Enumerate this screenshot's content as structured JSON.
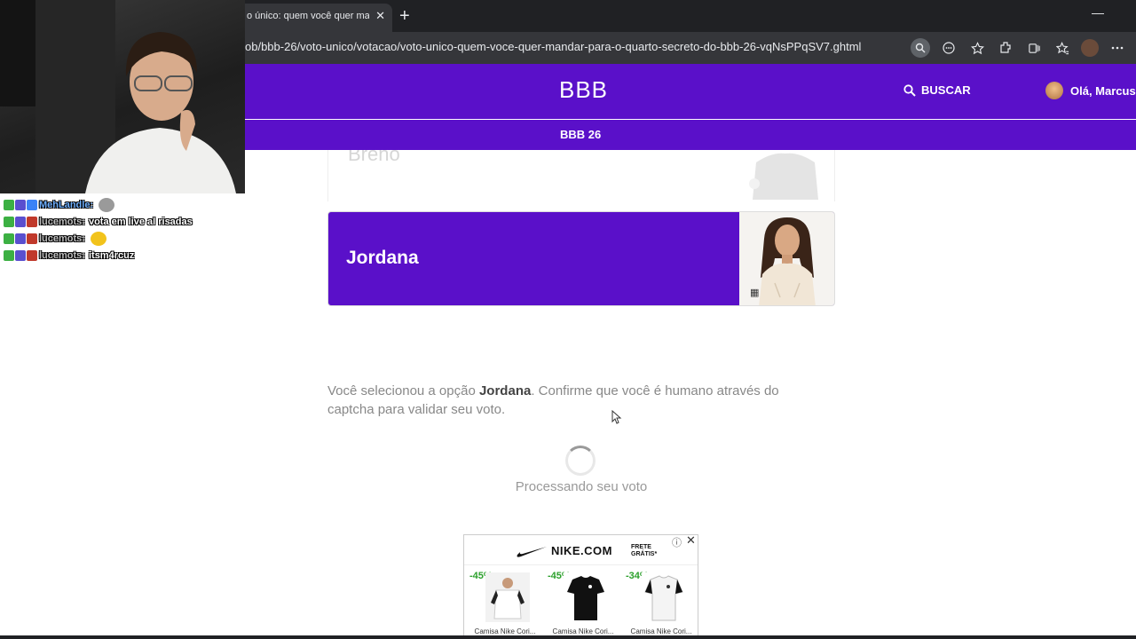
{
  "browser": {
    "tab_title": "o único: quem você quer mandar para o quarto secreto",
    "tab_close": "✕",
    "new_tab": "+",
    "minimize": "—",
    "url": "ob/bbb-26/voto-unico/votacao/voto-unico-quem-voce-quer-mandar-para-o-quarto-secreto-do-bbb-26-vqNsPPqSV7.ghtml",
    "toolbar_icons": [
      "zoom-icon",
      "reader-icon",
      "favorite-star-icon",
      "extensions-icon",
      "collections-icon",
      "favorites-icon",
      "profile-icon",
      "menu-icon"
    ]
  },
  "header": {
    "logo": "BBB",
    "search_label": "BUSCAR",
    "user_greeting": "Olá, Marcus",
    "subnav_label": "BBB 26",
    "brand_color": "#5a10c9"
  },
  "options": {
    "previous_name": "Breno",
    "selected_name": "Jordana"
  },
  "confirmation": {
    "prefix": "Você selecionou a opção ",
    "name": "Jordana",
    "suffix": ". Confirme que você é humano através do captcha para validar seu voto.",
    "processing": "Processando seu voto"
  },
  "ad": {
    "brand": "NIKE.COM",
    "shipping_line1": "FRETE",
    "shipping_line2": "GRÁTIS*",
    "info": "ⓘ",
    "close": "✕",
    "products": [
      {
        "discount": "-45%",
        "name": "Camisa Nike Cori..."
      },
      {
        "discount": "-45%",
        "name": "Camisa Nike Cori..."
      },
      {
        "discount": "-34%",
        "name": "Camisa Nike Cori..."
      }
    ]
  },
  "stream_chat": [
    {
      "user": "MehLandle:",
      "message": ""
    },
    {
      "user": "lucemots:",
      "message": "vota em live al risadas"
    },
    {
      "user": "lucemots:",
      "message": ""
    },
    {
      "user": "lucemots:",
      "message": "itsm4rcuz"
    }
  ]
}
